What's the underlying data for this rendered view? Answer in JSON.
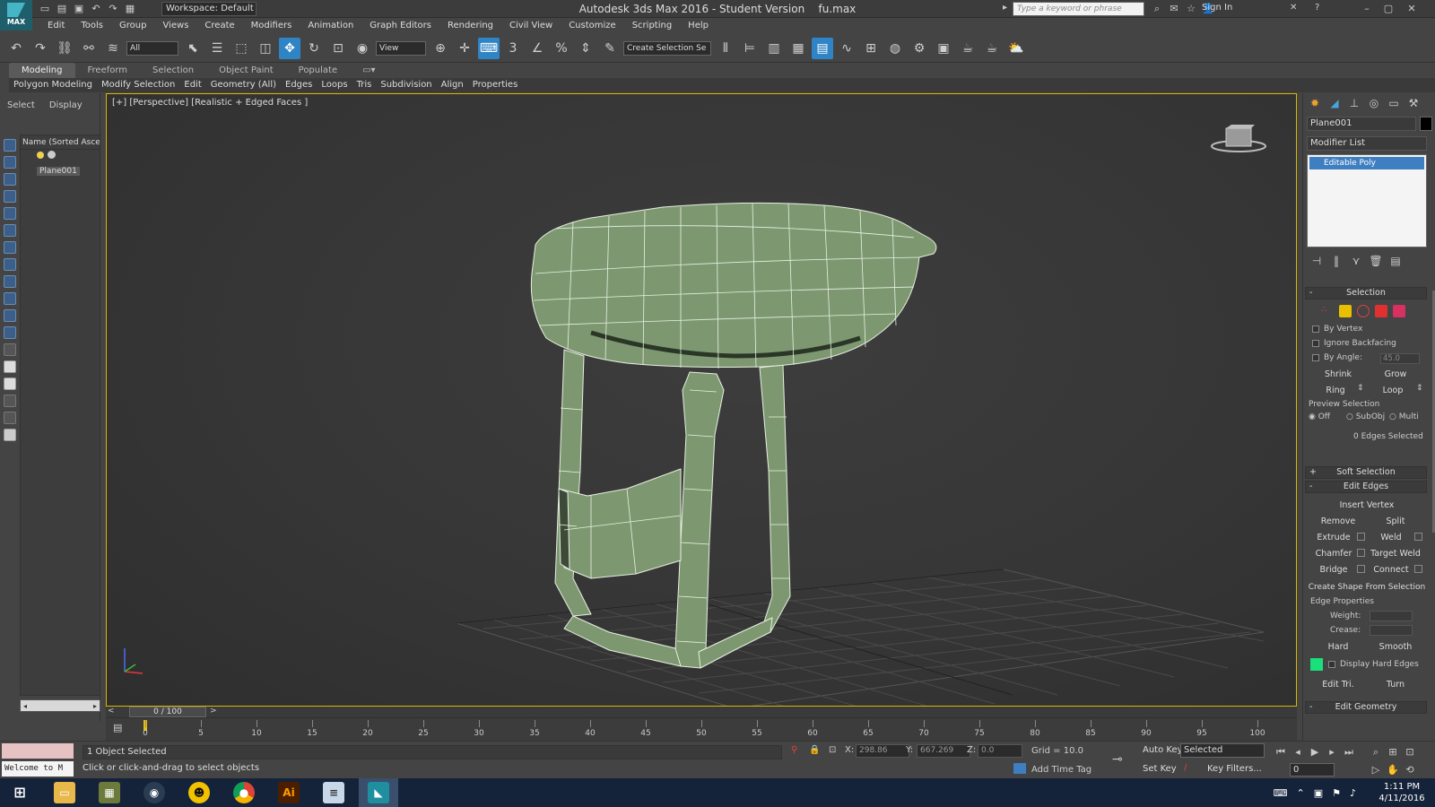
{
  "title_bar": {
    "logo_text": "MAX",
    "workspace": "Workspace: Default",
    "window_title": "Autodesk 3ds Max 2016 - Student Version",
    "file_name": "fu.max",
    "search_placeholder": "Type a keyword or phrase",
    "sign_in": "Sign In"
  },
  "menu": [
    "Edit",
    "Tools",
    "Group",
    "Views",
    "Create",
    "Modifiers",
    "Animation",
    "Graph Editors",
    "Rendering",
    "Civil View",
    "Customize",
    "Scripting",
    "Help"
  ],
  "toolbar": {
    "filter": "All",
    "ref_coord": "View",
    "snap_3": "3",
    "named_selection": "Create Selection Se"
  },
  "ribbon": {
    "tabs": [
      "Modeling",
      "Freeform",
      "Selection",
      "Object Paint",
      "Populate"
    ],
    "panels": [
      "Polygon Modeling",
      "Modify Selection",
      "Edit",
      "Geometry (All)",
      "Edges",
      "Loops",
      "Tris",
      "Subdivision",
      "Align",
      "Properties"
    ]
  },
  "explorer": {
    "tabs": [
      "Select",
      "Display"
    ],
    "column_header": "Name (Sorted Ascend",
    "object": "Plane001"
  },
  "viewport": {
    "label": "[+] [Perspective] [Realistic + Edged Faces ]"
  },
  "timeline": {
    "frame": "0 / 100",
    "ticks": [
      "0",
      "5",
      "10",
      "15",
      "20",
      "25",
      "30",
      "35",
      "40",
      "45",
      "50",
      "55",
      "60",
      "65",
      "70",
      "75",
      "80",
      "85",
      "90",
      "95",
      "100"
    ]
  },
  "status": {
    "maxscript_text": "Welcome to M",
    "selection": "1 Object Selected",
    "prompt": "Click or click-and-drag to select objects",
    "x_label": "X:",
    "x_value": "298.86",
    "y_label": "Y:",
    "y_value": "667.269",
    "z_label": "Z:",
    "z_value": "0.0",
    "grid": "Grid = 10.0",
    "add_time_tag": "Add Time Tag",
    "auto_key": "Auto Key",
    "set_key": "Set Key",
    "key_mode": "Selected",
    "key_filters": "Key Filters...",
    "current_frame": "0"
  },
  "command_panel": {
    "object_name": "Plane001",
    "modifier_list": "Modifier List",
    "stack_item": "Editable Poly",
    "selection_rollout": "Selection",
    "by_vertex": "By Vertex",
    "ignore_backfacing": "Ignore Backfacing",
    "by_angle": "By Angle:",
    "by_angle_value": "45.0",
    "shrink": "Shrink",
    "grow": "Grow",
    "ring": "Ring",
    "loop": "Loop",
    "preview_selection": "Preview Selection",
    "preview_off": "Off",
    "preview_subobj": "SubObj",
    "preview_multi": "Multi",
    "edges_selected": "0 Edges Selected",
    "soft_selection": "Soft Selection",
    "edit_edges": "Edit Edges",
    "insert_vertex": "Insert Vertex",
    "remove": "Remove",
    "split": "Split",
    "extrude": "Extrude",
    "weld": "Weld",
    "chamfer": "Chamfer",
    "target_weld": "Target Weld",
    "bridge": "Bridge",
    "connect": "Connect",
    "create_shape": "Create Shape From Selection",
    "edge_properties": "Edge Properties",
    "weight": "Weight:",
    "crease": "Crease:",
    "hard": "Hard",
    "smooth": "Smooth",
    "display_hard_edges": "Display Hard Edges",
    "edit_tri": "Edit Tri.",
    "turn": "Turn",
    "edit_geometry": "Edit Geometry",
    "hard_edge_color": "#19e07a"
  },
  "taskbar": {
    "time": "1:11 PM",
    "date": "4/11/2016",
    "apps": [
      "windows-start",
      "file-explorer",
      "calculator",
      "steam",
      "norton",
      "chrome",
      "illustrator",
      "notepad",
      "3ds-max"
    ]
  },
  "colors": {
    "accent_active": "#2f84c6",
    "viewport_border": "#d9b500",
    "mesh": "#7d9871"
  }
}
